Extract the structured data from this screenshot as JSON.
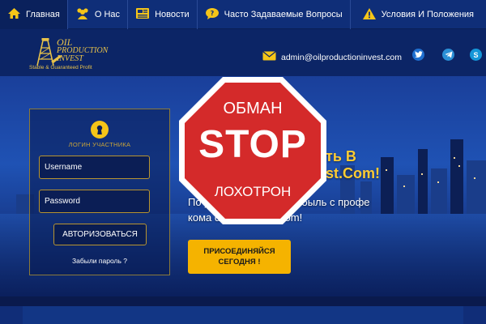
{
  "nav": {
    "items": [
      {
        "label": "Главная",
        "icon": "home-icon"
      },
      {
        "label": "О Нас",
        "icon": "users-icon"
      },
      {
        "label": "Новости",
        "icon": "newspaper-icon"
      },
      {
        "label": "Часто Задаваемые Вопросы",
        "icon": "faq-bubble-icon"
      },
      {
        "label": "Условия И Положения",
        "icon": "warning-icon"
      }
    ]
  },
  "header": {
    "logo_line1": "OIL",
    "logo_line2": "PRODUCTION",
    "logo_line3": "INVEST",
    "logo_tagline": "Stable & Guaranteed Profit",
    "email": "admin@oilproductioninvest.com",
    "social": [
      "twitter-icon",
      "telegram-icon",
      "skype-icon"
    ]
  },
  "login": {
    "title": "ЛОГИН УЧАСТНИКА",
    "username_placeholder": "Username",
    "password_placeholder": "Password",
    "submit_label": "АВТОРИЗОВАТЬСЯ",
    "forgot_label": "Забыли пароль ?"
  },
  "hero": {
    "heading_line1": "ать В",
    "heading_line2": "est.Com!",
    "sub_line1": "По                ую ежедневную прибыль с профе",
    "sub_line2": "кома          ductionInvest.com!",
    "join_label_line1": "ПРИСОЕДИНЯЙСЯ",
    "join_label_line2": "СЕГОДНЯ !"
  },
  "stop_sign": {
    "top": "ОБМАН",
    "middle": "STOP",
    "bottom": "ЛОХОТРОН",
    "color": "#d42a2a"
  },
  "colors": {
    "nav_bg": "#0f2e78",
    "accent_gold": "#ffcc33",
    "button_yellow": "#f5b300"
  }
}
